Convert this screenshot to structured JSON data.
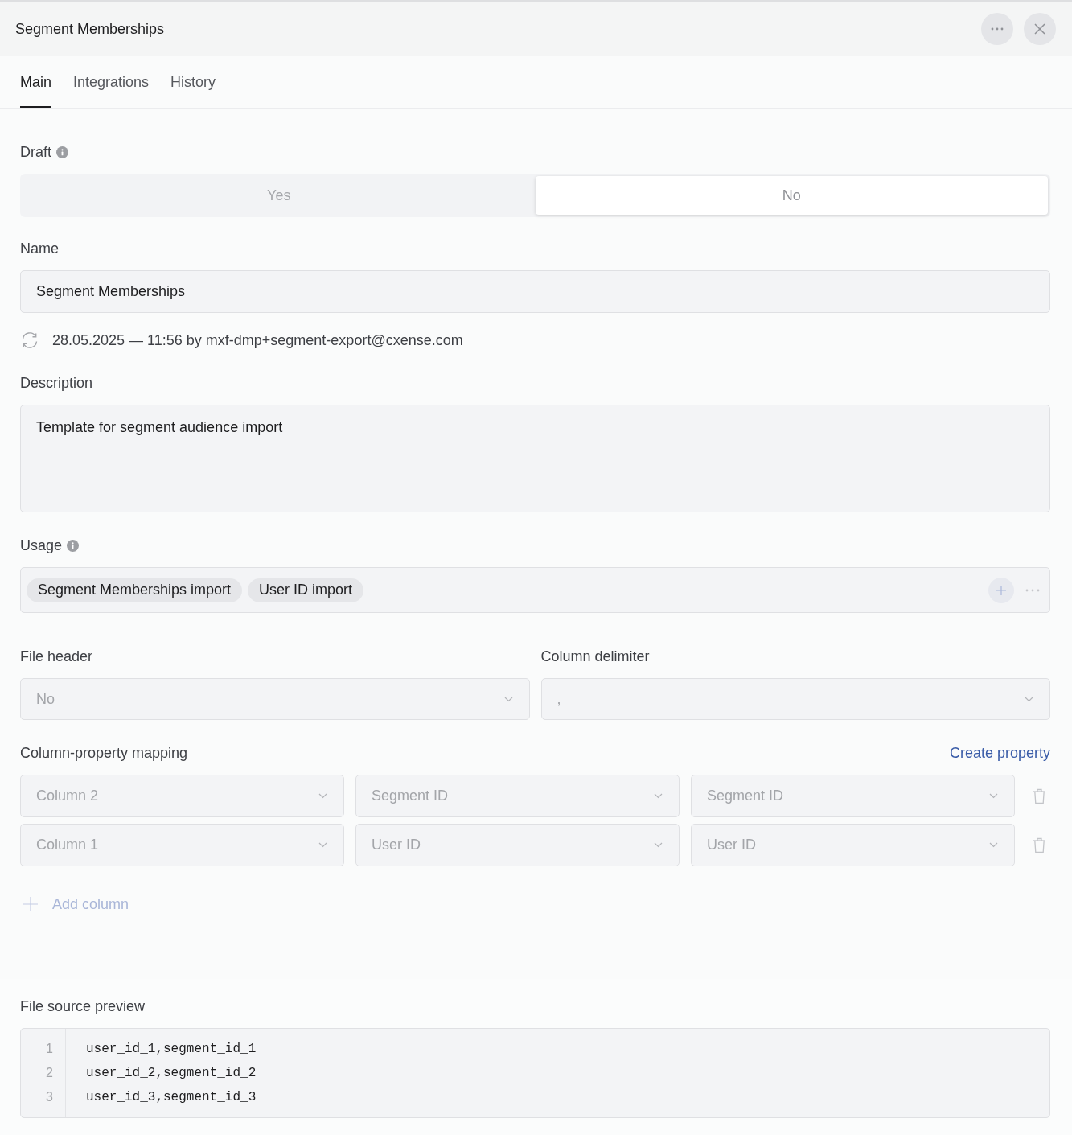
{
  "window": {
    "title": "Segment Memberships"
  },
  "tabs": [
    {
      "label": "Main",
      "selected": true
    },
    {
      "label": "Integrations",
      "selected": false
    },
    {
      "label": "History",
      "selected": false
    }
  ],
  "draft": {
    "label": "Draft",
    "options": [
      {
        "label": "Yes",
        "selected": false
      },
      {
        "label": "No",
        "selected": true
      }
    ]
  },
  "name": {
    "label": "Name",
    "value": "Segment Memberships"
  },
  "updated": "28.05.2025 — 11:56 by mxf-dmp+segment-export@cxense.com",
  "description": {
    "label": "Description",
    "value": "Template for segment audience import"
  },
  "usage": {
    "label": "Usage",
    "tags": [
      "Segment Memberships import",
      "User ID import"
    ]
  },
  "file_header": {
    "label": "File header",
    "value": "No",
    "disabled": true
  },
  "column_delimiter": {
    "label": "Column delimiter",
    "value": ",",
    "disabled": true
  },
  "mapping": {
    "label": "Column-property mapping",
    "link": "Create property",
    "rows": [
      {
        "cells": [
          "Column 2",
          "Segment ID",
          "Segment ID"
        ],
        "disabled": true
      },
      {
        "cells": [
          "Column 1",
          "User ID",
          "User ID"
        ],
        "disabled": true
      }
    ],
    "add_button": {
      "label": "Add column",
      "disabled": true
    }
  },
  "preview": {
    "label": "File source preview",
    "lines": [
      {
        "number": "1",
        "text": "user_id_1,segment_id_1"
      },
      {
        "number": "2",
        "text": "user_id_2,segment_id_2"
      },
      {
        "number": "3",
        "text": "user_id_3,segment_id_3"
      }
    ]
  }
}
